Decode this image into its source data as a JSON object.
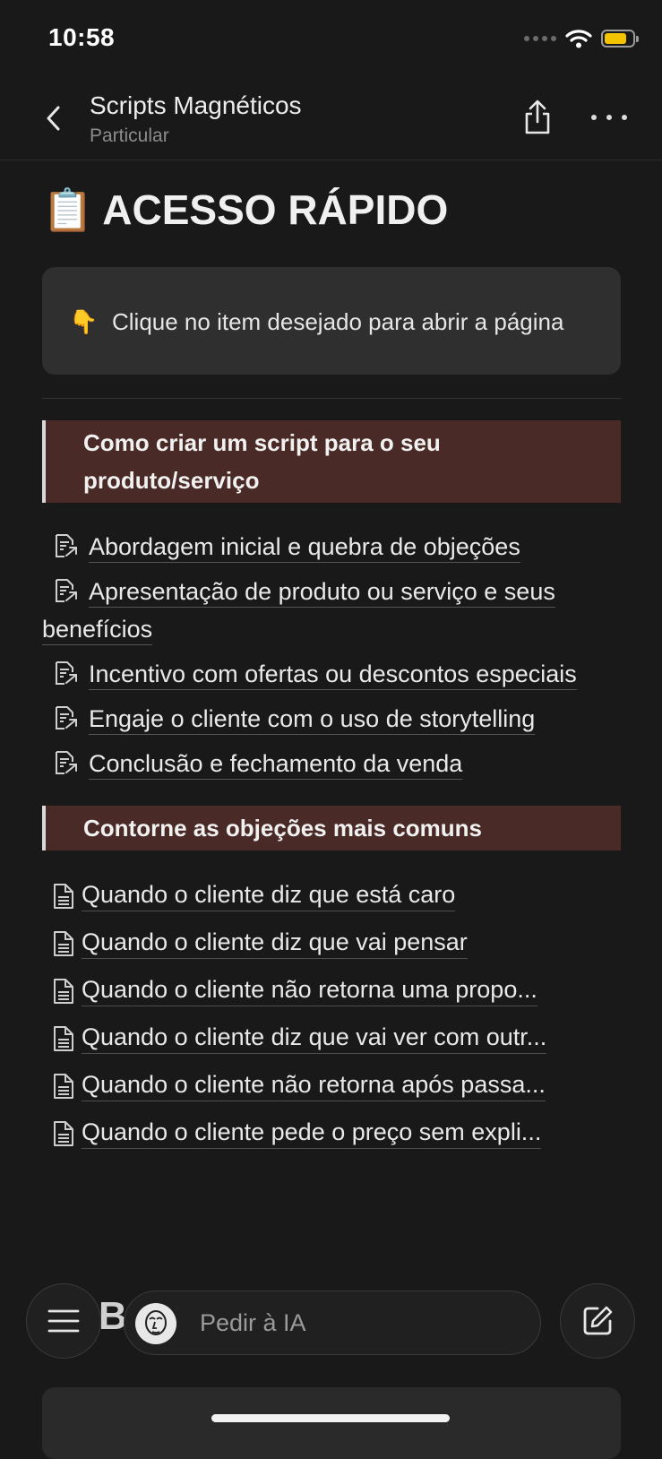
{
  "status_bar": {
    "time": "10:58"
  },
  "nav": {
    "title": "Scripts Magnéticos",
    "subtitle": "Particular"
  },
  "page": {
    "icon": "📋",
    "heading": "ACESSO RÁPIDO",
    "callout": {
      "emoji": "👇",
      "text": "Clique no item desejado para abrir a página"
    }
  },
  "sections": [
    {
      "title": "Como criar um script para o seu produto/serviço",
      "items": [
        {
          "label": "Abordagem inicial e quebra de objeções",
          "icon": "linked-page-icon"
        },
        {
          "label": "Apresentação de produto ou serviço e seus benefícios",
          "icon": "linked-page-icon"
        },
        {
          "label": "Incentivo com ofertas ou descontos especiais",
          "icon": "linked-page-icon"
        },
        {
          "label": "Engaje o cliente com o uso de storytelling",
          "icon": "linked-page-icon"
        },
        {
          "label": "Conclusão e fechamento da venda",
          "icon": "linked-page-icon"
        }
      ]
    },
    {
      "title": "Contorne as objeções mais comuns",
      "items": [
        {
          "label": "Quando o cliente diz que está caro",
          "icon": "page-icon"
        },
        {
          "label": "Quando o cliente diz que vai pensar",
          "icon": "page-icon"
        },
        {
          "label": "Quando o cliente não retorna uma propo...",
          "icon": "page-icon"
        },
        {
          "label": "Quando o cliente diz que vai ver com outr...",
          "icon": "page-icon"
        },
        {
          "label": "Quando o cliente não retorna após passa...",
          "icon": "page-icon"
        },
        {
          "label": "Quando o cliente pede o preço sem expli...",
          "icon": "page-icon"
        }
      ]
    }
  ],
  "bottom_bar": {
    "ask_placeholder": "Pedir à IA",
    "behind_text": "B"
  },
  "colors": {
    "background": "#191919",
    "callout": "#2f2f2f",
    "section_header": "#4a2a26",
    "battery": "#f2c400"
  }
}
